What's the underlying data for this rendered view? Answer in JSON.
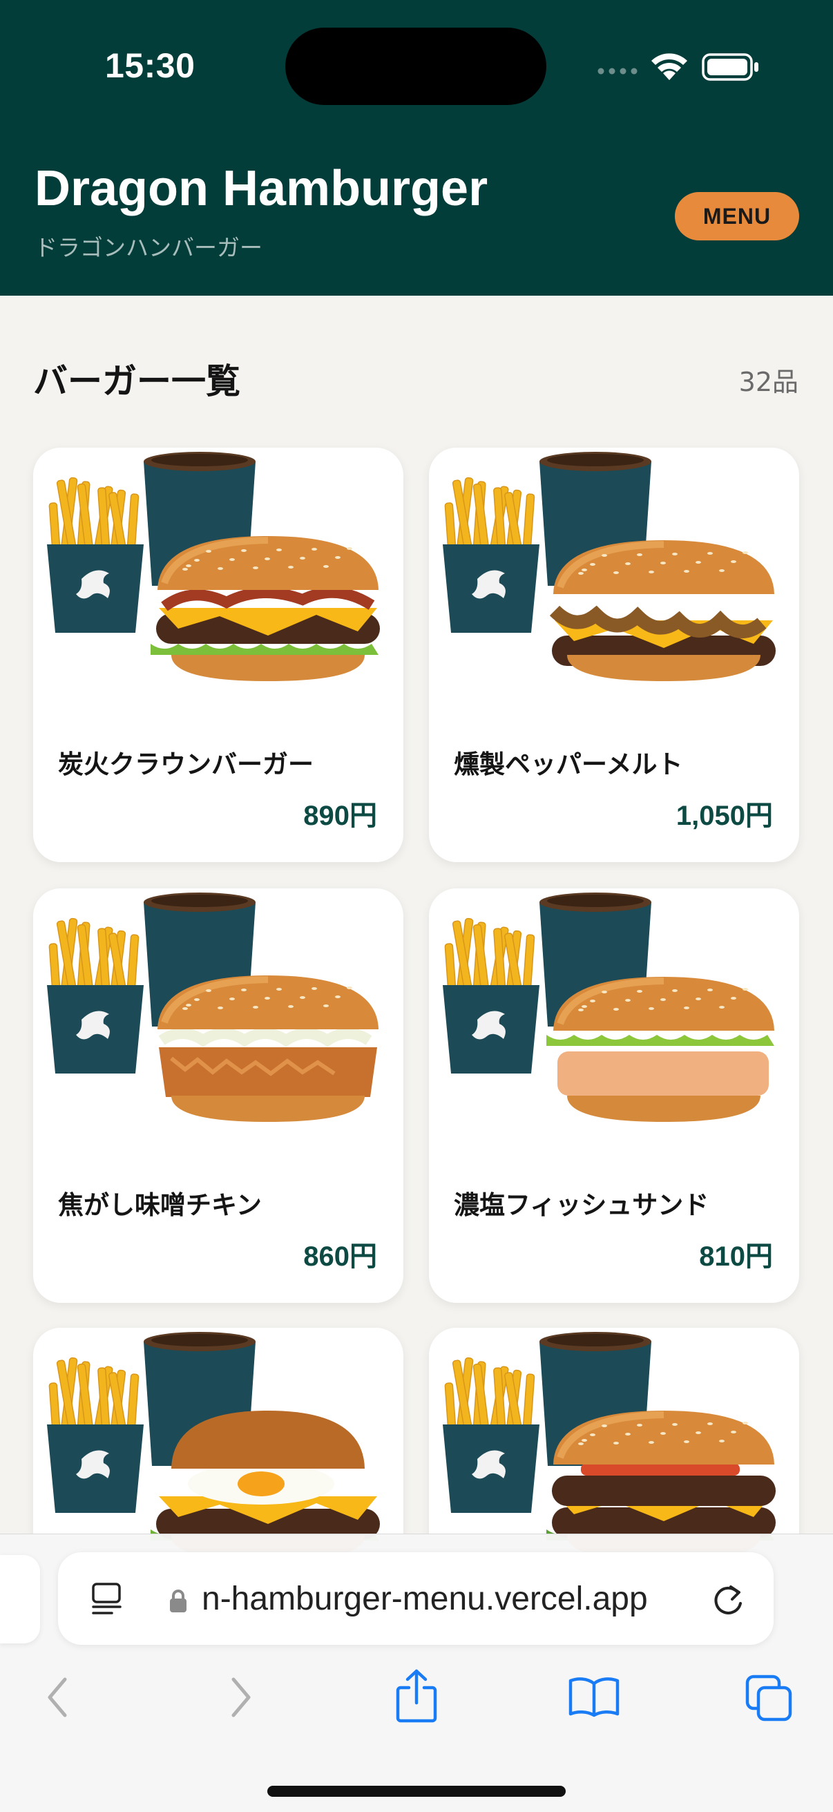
{
  "status_bar": {
    "time": "15:30"
  },
  "header": {
    "title": "Dragon Hamburger",
    "subtitle": "ドラゴンハンバーガー",
    "menu_label": "MENU"
  },
  "section": {
    "title": "バーガー一覧",
    "count": "32品"
  },
  "items": [
    {
      "name": "炭火クラウンバーガー",
      "price": "890円",
      "variant": "bacon"
    },
    {
      "name": "燻製ペッパーメルト",
      "price": "1,050円",
      "variant": "onion"
    },
    {
      "name": "焦がし味噌チキン",
      "price": "860円",
      "variant": "chicken"
    },
    {
      "name": "濃塩フィッシュサンド",
      "price": "810円",
      "variant": "fish"
    },
    {
      "name": "",
      "price": "",
      "variant": "egg"
    },
    {
      "name": "",
      "price": "",
      "variant": "double"
    }
  ],
  "browser": {
    "url": "n-hamburger-menu.vercel.app"
  },
  "colors": {
    "header_bg": "#033d3a",
    "accent": "#e88a3c",
    "price": "#0d4a44",
    "page_bg": "#f4f3f0",
    "ios_blue": "#1a7cf5"
  }
}
